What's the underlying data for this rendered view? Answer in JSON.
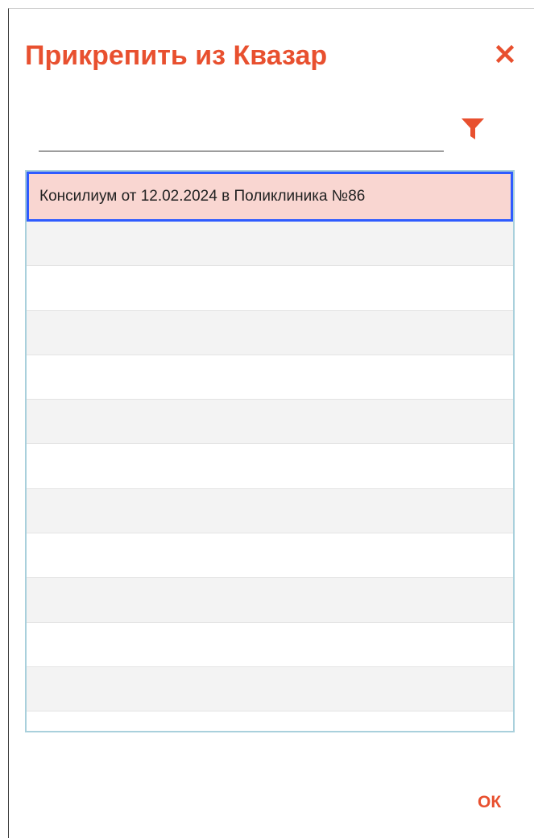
{
  "dialog": {
    "title": "Прикрепить из Квазар",
    "close_icon": "close-icon",
    "filter_icon": "filter-icon",
    "ok_label": "ОК",
    "accent_color": "#e8502f"
  },
  "search": {
    "value": "",
    "placeholder": ""
  },
  "list": {
    "items": [
      {
        "label": "Консилиум от 12.02.2024 в Поликлиника №86",
        "selected": true
      },
      {
        "label": ""
      },
      {
        "label": ""
      },
      {
        "label": ""
      },
      {
        "label": ""
      },
      {
        "label": ""
      },
      {
        "label": ""
      },
      {
        "label": ""
      },
      {
        "label": ""
      },
      {
        "label": ""
      },
      {
        "label": ""
      },
      {
        "label": ""
      }
    ]
  }
}
